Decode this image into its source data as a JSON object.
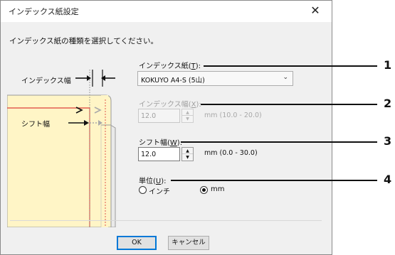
{
  "dialog": {
    "title": "インデックス紙設定",
    "close_glyph": "✕",
    "instruction": "インデックス紙の種類を選択してください。"
  },
  "illustration": {
    "index_width_label": "インデックス幅",
    "shift_width_label": "シフト幅",
    "outline_color": "#e2574c",
    "paper_color": "#fff5c6"
  },
  "index_paper": {
    "label_prefix": "インデックス紙(",
    "label_key": "T",
    "label_suffix": "):",
    "selected": "KOKUYO A4-S (5山)"
  },
  "index_width": {
    "label_prefix": "インデックス幅(",
    "label_key": "X",
    "label_suffix": "):",
    "value": "12.0",
    "range": "mm (10.0 - 20.0)",
    "enabled": false
  },
  "shift_width": {
    "label_prefix": "シフト幅(",
    "label_key": "W",
    "label_suffix": "):",
    "value": "12.0",
    "range": "mm (0.0 - 30.0)",
    "enabled": true
  },
  "unit": {
    "label_prefix": "単位(",
    "label_key": "U",
    "label_suffix": "):",
    "options": [
      "インチ",
      "mm"
    ],
    "selected": "mm"
  },
  "buttons": {
    "ok": "OK",
    "cancel": "キャンセル"
  },
  "callouts": [
    "1",
    "2",
    "3",
    "4"
  ]
}
